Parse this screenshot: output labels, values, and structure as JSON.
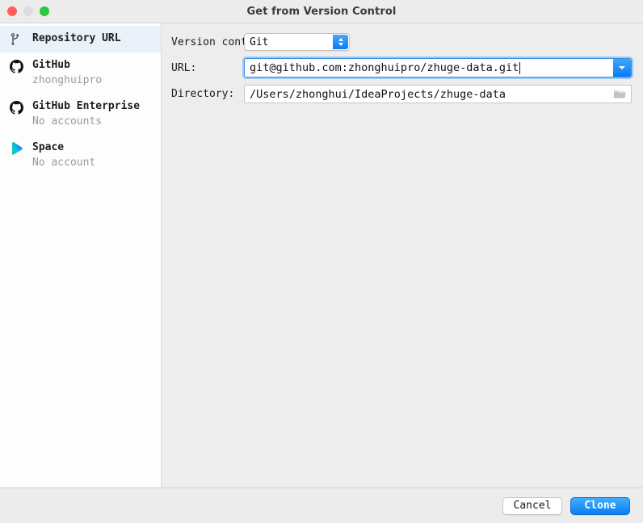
{
  "window": {
    "title": "Get from Version Control",
    "traffic_lights": [
      "close",
      "minimize",
      "zoom"
    ]
  },
  "sidebar": {
    "items": [
      {
        "icon": "git-branch-icon",
        "title": "Repository URL",
        "subtitle": "",
        "selected": true
      },
      {
        "icon": "github-icon",
        "title": "GitHub",
        "subtitle": "zhonghuipro",
        "selected": false
      },
      {
        "icon": "github-icon",
        "title": "GitHub Enterprise",
        "subtitle": "No accounts",
        "selected": false
      },
      {
        "icon": "space-icon",
        "title": "Space",
        "subtitle": "No account",
        "selected": false
      }
    ]
  },
  "form": {
    "version_control": {
      "label": "Version control:",
      "value": "Git",
      "options": [
        "Git"
      ]
    },
    "url": {
      "label": "URL:",
      "value": "git@github.com:zhonghuipro/zhuge-data.git",
      "placeholder": ""
    },
    "directory": {
      "label": "Directory:",
      "value": "/Users/zhonghui/IdeaProjects/zhuge-data",
      "placeholder": "",
      "browse_icon": "folder-icon"
    }
  },
  "footer": {
    "cancel_label": "Cancel",
    "clone_label": "Clone"
  },
  "colors": {
    "accent": "#0a7ef5",
    "selected_row": "#e9f1fb",
    "window_bg": "#ececec",
    "panel_bg": "#ededed",
    "sidebar_bg": "#fdfdfd",
    "close_light": "#ff5f57",
    "min_light": "#dddddd",
    "zoom_light": "#28c840"
  }
}
